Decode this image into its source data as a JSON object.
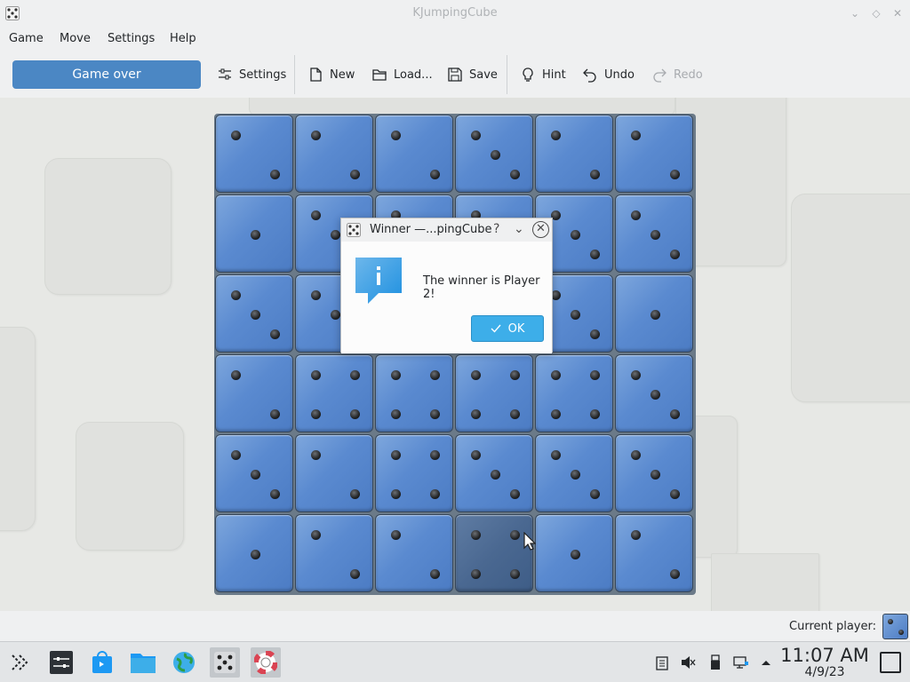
{
  "window": {
    "title": "KJumpingCube"
  },
  "menubar": {
    "items": [
      "Game",
      "Move",
      "Settings",
      "Help"
    ]
  },
  "toolbar": {
    "status_label": "Game over",
    "settings_label": "Settings",
    "new_label": "New",
    "load_label": "Load...",
    "save_label": "Save",
    "hint_label": "Hint",
    "undo_label": "Undo",
    "redo_label": "Redo"
  },
  "board": {
    "rows": 6,
    "cols": 6,
    "cell_values": [
      [
        2,
        2,
        2,
        3,
        2,
        2
      ],
      [
        1,
        3,
        3,
        3,
        3,
        3
      ],
      [
        3,
        3,
        3,
        3,
        3,
        1
      ],
      [
        2,
        4,
        4,
        4,
        4,
        3
      ],
      [
        3,
        2,
        4,
        3,
        3,
        3
      ],
      [
        1,
        2,
        2,
        4,
        1,
        2
      ]
    ],
    "highlighted_cell": [
      5,
      3
    ],
    "colors": {
      "player2": "#5a8ad0",
      "highlight": "#4a6891"
    }
  },
  "dialog": {
    "title": "Winner —...pingCube",
    "help_glyph": "?",
    "message": "The winner is Player 2!",
    "ok_label": "OK"
  },
  "statusbar": {
    "current_player_label": "Current player:"
  },
  "taskbar": {
    "clock_time": "11:07 AM",
    "clock_date": "4/9/23"
  }
}
